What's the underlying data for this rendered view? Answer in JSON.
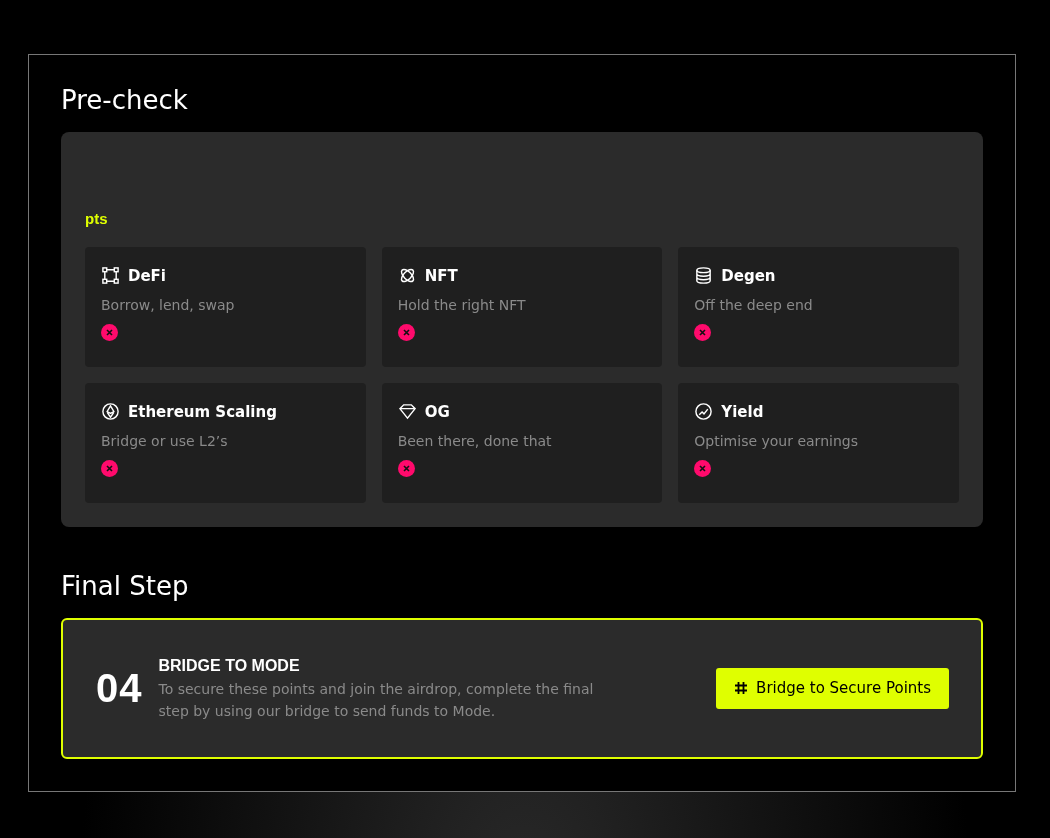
{
  "precheck": {
    "title": "Pre-check",
    "points_label": "pts",
    "categories": [
      {
        "title": "DeFi",
        "description": "Borrow, lend, swap",
        "completed": false
      },
      {
        "title": "NFT",
        "description": "Hold the right NFT",
        "completed": false
      },
      {
        "title": "Degen",
        "description": "Off the deep end",
        "completed": false
      },
      {
        "title": "Ethereum Scaling",
        "description": "Bridge or use L2’s",
        "completed": false
      },
      {
        "title": "OG",
        "description": "Been there, done that",
        "completed": false
      },
      {
        "title": "Yield",
        "description": "Optimise your earnings",
        "completed": false
      }
    ]
  },
  "final_step": {
    "title": "Final Step",
    "number": "04",
    "heading": "BRIDGE TO MODE",
    "description": "To secure these points and join the airdrop, complete the final step by using our bridge to send funds to Mode.",
    "button": "Bridge to Secure Points"
  }
}
